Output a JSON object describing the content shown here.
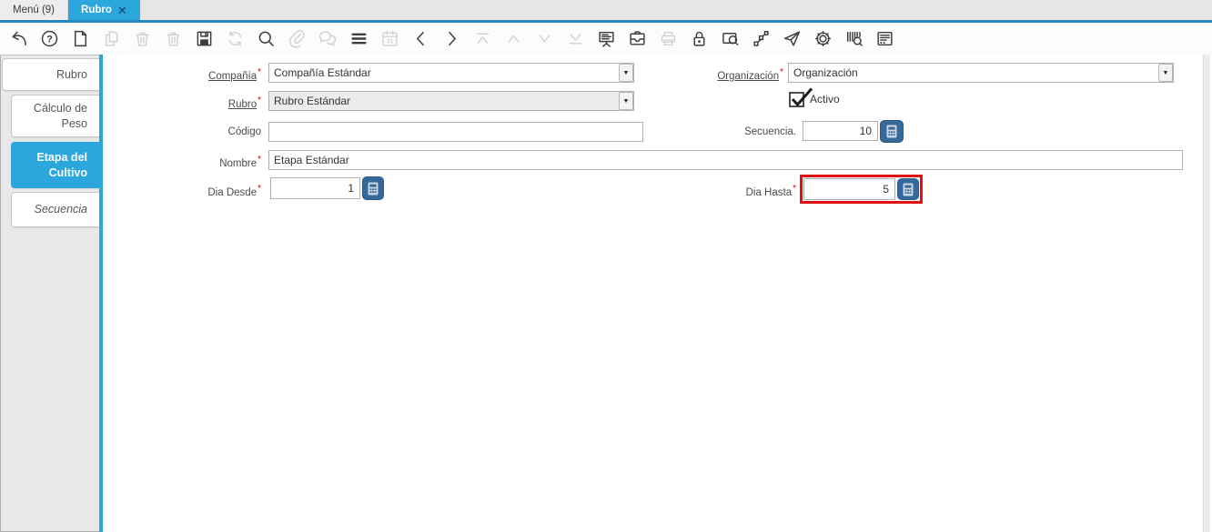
{
  "ui": {
    "required_marker": "*",
    "combo_arrow": "▼"
  },
  "window_tabs": [
    {
      "label": "Menú (9)",
      "active": false
    },
    {
      "label": "Rubro",
      "active": true,
      "closable": true
    }
  ],
  "toolbar": {
    "icons": [
      {
        "name": "ignore-changes",
        "enabled": true
      },
      {
        "name": "help",
        "enabled": true
      },
      {
        "name": "new-record",
        "enabled": true
      },
      {
        "name": "copy-record",
        "enabled": false
      },
      {
        "name": "delete-record",
        "enabled": false
      },
      {
        "name": "delete-selection",
        "enabled": false
      },
      {
        "name": "save",
        "enabled": true
      },
      {
        "name": "refresh",
        "enabled": false
      },
      {
        "name": "find",
        "enabled": true
      },
      {
        "name": "attachment",
        "enabled": false
      },
      {
        "name": "chat",
        "enabled": false
      },
      {
        "name": "toggle-grid",
        "enabled": true
      },
      {
        "name": "calendar",
        "enabled": false
      },
      {
        "name": "previous-record",
        "enabled": true
      },
      {
        "name": "next-record",
        "enabled": true
      },
      {
        "name": "first-record",
        "enabled": false
      },
      {
        "name": "parent-record",
        "enabled": false
      },
      {
        "name": "detail-record",
        "enabled": false
      },
      {
        "name": "last-record",
        "enabled": false
      },
      {
        "name": "report",
        "enabled": true
      },
      {
        "name": "archive",
        "enabled": true
      },
      {
        "name": "print",
        "enabled": false
      },
      {
        "name": "private-lock",
        "enabled": true
      },
      {
        "name": "zoom-across",
        "enabled": true
      },
      {
        "name": "workflow",
        "enabled": true
      },
      {
        "name": "send-request",
        "enabled": true
      },
      {
        "name": "preferences",
        "enabled": true
      },
      {
        "name": "product-info",
        "enabled": true
      },
      {
        "name": "process-log",
        "enabled": true
      }
    ]
  },
  "sidebar": {
    "tabs": [
      {
        "label": "Rubro",
        "active": false
      },
      {
        "label": "Cálculo de Peso",
        "active": false
      },
      {
        "label": "Etapa del Cultivo",
        "active": true
      },
      {
        "label": "Secuencia",
        "active": false,
        "italic": true
      }
    ]
  },
  "form": {
    "fields": {
      "compania": {
        "label": "Compañía",
        "required": true,
        "type": "combobox",
        "value": "Compañía Estándar"
      },
      "organizacion": {
        "label": "Organización",
        "required": true,
        "type": "combobox",
        "value": "Organización"
      },
      "rubro": {
        "label": "Rubro",
        "required": true,
        "type": "combobox",
        "value": "Rubro Estándar",
        "readonly": true
      },
      "activo": {
        "label": "Activo",
        "checked": true
      },
      "codigo": {
        "label": "Código",
        "value": ""
      },
      "secuencia": {
        "label": "Secuencia.",
        "value": "10"
      },
      "nombre": {
        "label": "Nombre",
        "required": true,
        "value": "Etapa Estándar"
      },
      "dia_desde": {
        "label": "Dia Desde",
        "required": true,
        "value": "1"
      },
      "dia_hasta": {
        "label": "Dia Hasta",
        "required": true,
        "value": "5",
        "highlighted": true
      }
    }
  },
  "colors": {
    "accent_blue": "#2BA7DE",
    "tab_underline_blue": "#2089BF",
    "calc_button_blue": "#35699A",
    "highlight_red": "#E11111",
    "required_red": "#D40000",
    "disabled_field_bg": "#ECECEC"
  }
}
